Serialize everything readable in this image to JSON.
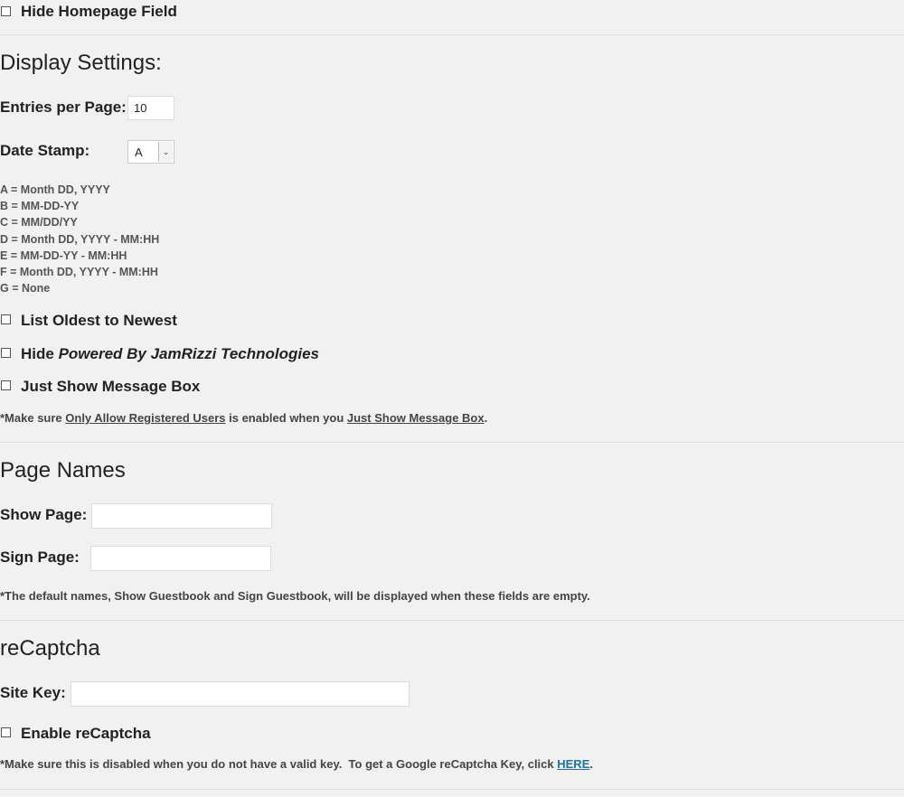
{
  "hide_homepage": {
    "label": "Hide Homepage Field",
    "checked": false
  },
  "display_settings": {
    "title": "Display Settings:",
    "entries_label": "Entries per Page:",
    "entries_value": "10",
    "date_stamp_label": "Date Stamp:",
    "date_stamp_value": "A",
    "legend": [
      "A = Month DD, YYYY",
      "B = MM-DD-YY",
      "C = MM/DD/YY",
      "D = Month DD, YYYY - MM:HH",
      "E = MM-DD-YY - MM:HH",
      "F = Month DD, YYYY - MM:HH",
      "G = None"
    ],
    "list_oldest": {
      "label": "List Oldest to Newest",
      "checked": false
    },
    "hide_powered": {
      "prefix": "Hide ",
      "italic": "Powered By JamRizzi Technologies",
      "checked": false
    },
    "just_show": {
      "label": "Just Show Message Box",
      "checked": false
    },
    "note": {
      "t1": "*Make sure ",
      "link1": "Only Allow Registered Users",
      "t2": " is enabled when you ",
      "link2": "Just Show Message Box",
      "t3": "."
    }
  },
  "page_names": {
    "title": "Page Names",
    "show_label": "Show Page:",
    "show_value": "",
    "sign_label": "Sign Page:",
    "sign_value": "",
    "note": "*The default names, Show Guestbook and Sign Guestbook, will be displayed when these fields are empty."
  },
  "recaptcha": {
    "title": "reCaptcha",
    "site_key_label": "Site Key:",
    "site_key_value": "",
    "enable": {
      "label": "Enable reCaptcha",
      "checked": false
    },
    "note_text": "*Make sure this is disabled when you do not have a valid key.  To get a Google reCaptcha Key, click ",
    "note_link": "HERE",
    "note_end": "."
  },
  "colors": {
    "background": "#f1f1f1",
    "link": "#21759b",
    "text": "#222222"
  }
}
